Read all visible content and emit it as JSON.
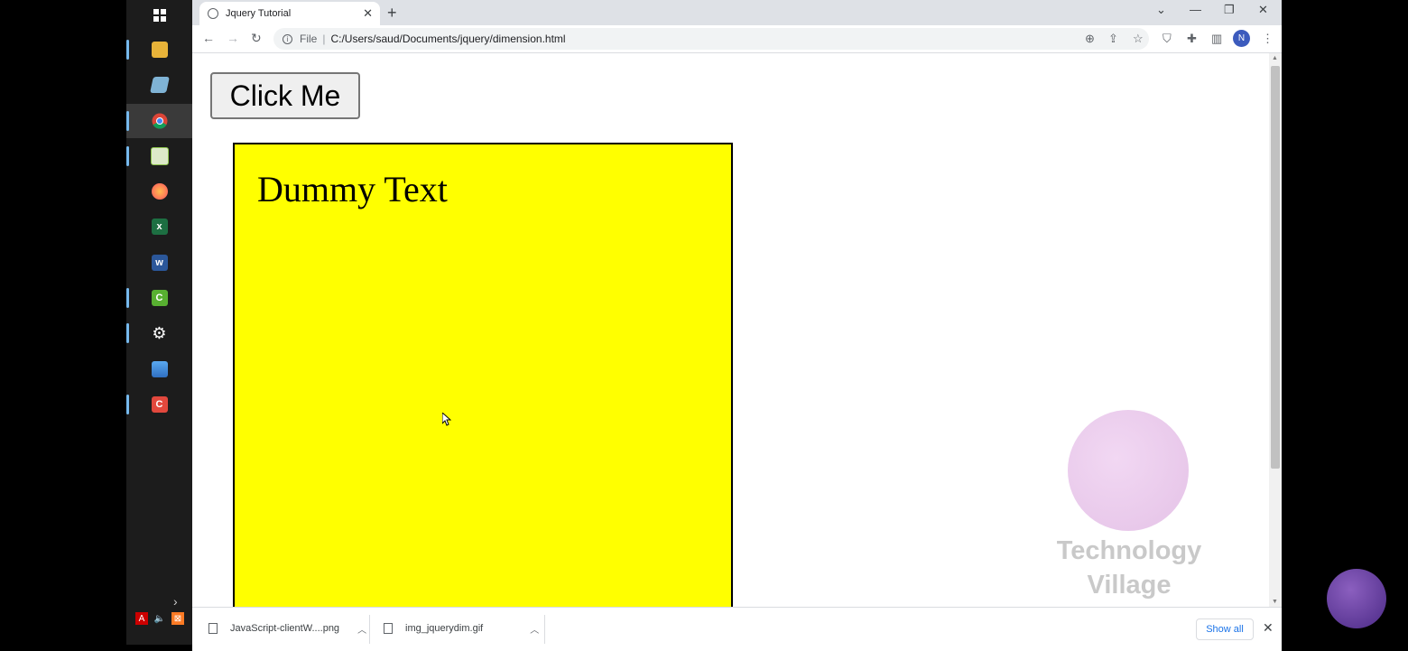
{
  "taskbar": {
    "items": [
      {
        "name": "windows-start-icon",
        "color": "#ffffff"
      },
      {
        "name": "file-explorer-icon",
        "color": "#e8b339"
      },
      {
        "name": "app-icon",
        "color": "#7fb3d5"
      },
      {
        "name": "chrome-icon",
        "color": "#34a853"
      },
      {
        "name": "notepad-icon",
        "color": "#8bc34a"
      },
      {
        "name": "firefox-icon",
        "color": "#ff7139"
      },
      {
        "name": "excel-icon",
        "color": "#1d6f42"
      },
      {
        "name": "word-icon",
        "color": "#2b579a"
      },
      {
        "name": "camtasia-icon",
        "color": "#58b031"
      },
      {
        "name": "settings-icon",
        "color": "#ffffff"
      },
      {
        "name": "photos-icon",
        "color": "#3a87d9"
      },
      {
        "name": "camtasia-recorder-icon",
        "color": "#e2483d"
      }
    ]
  },
  "tab": {
    "title": "Jquery Tutorial"
  },
  "address": {
    "scheme_label": "File",
    "url": "C:/Users/saud/Documents/jquery/dimension.html"
  },
  "profile": {
    "initial": "N"
  },
  "page": {
    "button_label": "Click Me",
    "box_text": "Dummy Text",
    "box_color": "#ffff00"
  },
  "watermark": {
    "line1": "Technology",
    "line2": "Village"
  },
  "downloads": {
    "items": [
      {
        "filename": "JavaScript-clientW....png"
      },
      {
        "filename": "img_jquerydim.gif"
      }
    ],
    "show_all_label": "Show all"
  }
}
